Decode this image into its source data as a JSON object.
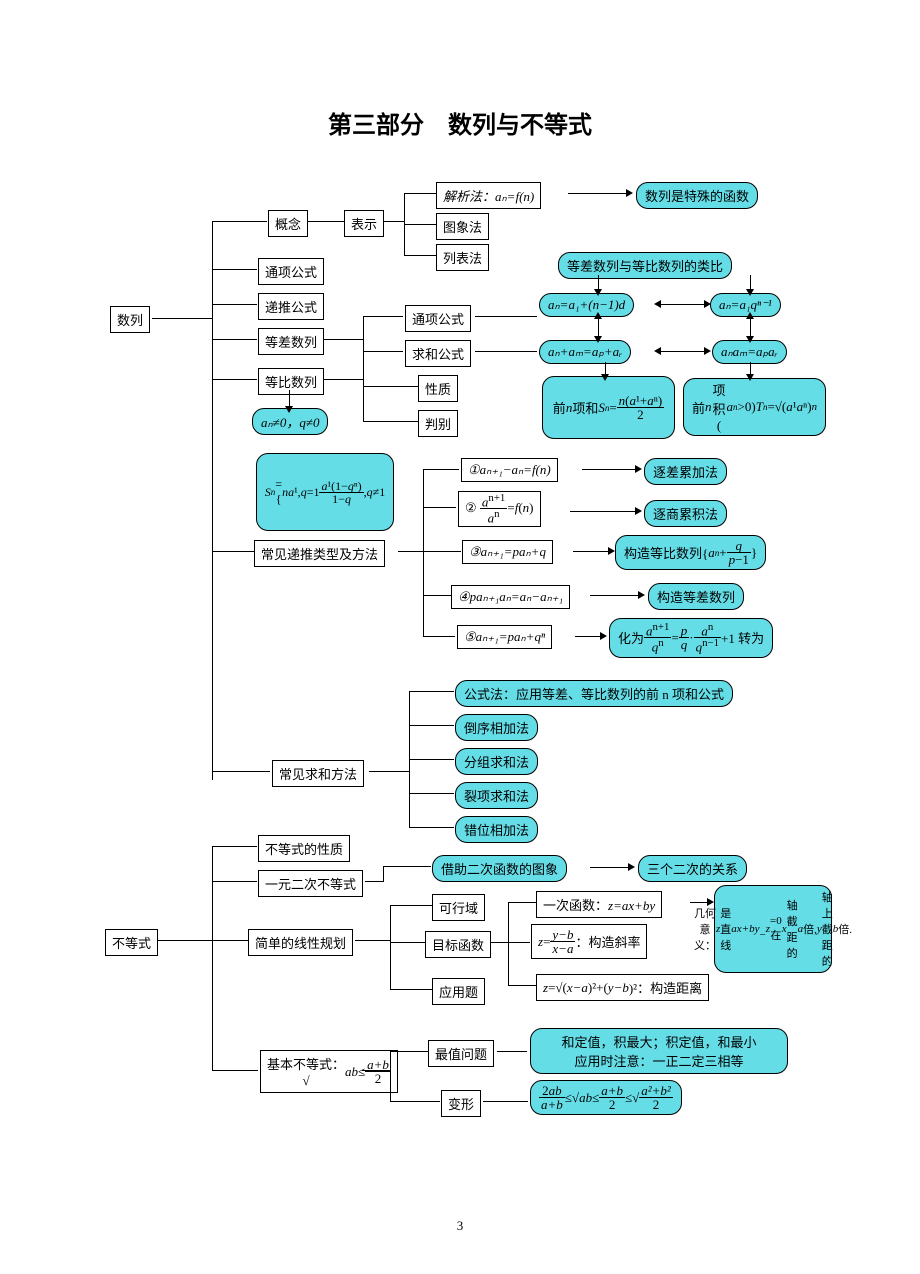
{
  "title": "第三部分　数列与不等式",
  "page": "3",
  "seq": "数列",
  "ineq": "不等式",
  "concept": "概念",
  "repr": "表示",
  "analytic": "解析法：aₙ=f(n)",
  "graph": "图象法",
  "list": "列表法",
  "special": "数列是特殊的函数",
  "general": "通项公式",
  "recur": "递推公式",
  "arith": "等差数列",
  "geom": "等比数列",
  "cond": "aₙ≠0，q≠0",
  "gen2": "通项公式",
  "sum2": "求和公式",
  "prop": "性质",
  "judge": "判别",
  "analogy": "等差数列与等比数列的类比",
  "f1": "aₙ=a₁+(n−1)d",
  "f2": "aₙ=a₁qⁿ⁻¹",
  "f3": "aₙ+aₘ=aₚ+aᵣ",
  "f4": "aₙaₘ=aₚaᵣ",
  "sn_label": "前 n 项和",
  "sn_formula": "Sₙ = n(a¹+aⁿ)/2",
  "tn_label": "前 n 项积(aₙ>0)",
  "tn_formula": "Tₙ=√(a¹aⁿ)ⁿ",
  "sn_block": "Sₙ=\\n na¹, q=1\\n a¹(1−qⁿ)/(1−q), q≠1",
  "ctype": "常见递推类型及方法",
  "c1": "①aₙ₊₁−aₙ=f(n)",
  "c2": "② aⁿ⁺¹/aⁿ =f(n)",
  "c3": "③aₙ₊₁=paₙ+q",
  "c4": "④paₙ₊₁aₙ=aₙ−aₙ₊₁",
  "c5": "⑤aₙ₊₁=paₙ+qⁿ",
  "m1": "逐差累加法",
  "m2": "逐商累积法",
  "m3": "构造等比数列{aₙ+ q/(p−1)}",
  "m4": "构造等差数列",
  "m5": "化为 aⁿ⁺¹/qⁿ = p/q · aⁿ/qⁿ⁻¹ +1 转为",
  "summethod": "常见求和方法",
  "s1": "公式法：应用等差、等比数列的前 n 项和公式",
  "s2": "倒序相加法",
  "s3": "分组求和法",
  "s4": "裂项求和法",
  "s5": "错位相加法",
  "ineq_prop": "不等式的性质",
  "quad": "一元二次不等式",
  "quad_img": "借助二次函数的图象",
  "three2": "三个二次的关系",
  "lp": "简单的线性规划",
  "feasible": "可行域",
  "obj": "目标函数",
  "appl": "应用题",
  "lin": "一次函数：z=ax+by",
  "slope": "z=(y−b)/(x−a)：构造斜率",
  "dist": "z=√(x−a)²+(y−b)²：构造距离",
  "geo": "几何意义：\\nz 是直线 ax+by\\n−z=0 在 x 轴截\\n距的 a 倍，y 轴上\\n截距的 b 倍.",
  "basic": "基本不等式：\\n√ab≤(a+b)/2",
  "opt": "最值问题",
  "var": "变形",
  "opt_note": "和定值，积最大；积定值，和最小\\n应用时注意：一正二定三相等",
  "var_formula": "2ab/(a+b) ≤ √ab ≤ (a+b)/2 ≤ √((a²+b²)/2)"
}
